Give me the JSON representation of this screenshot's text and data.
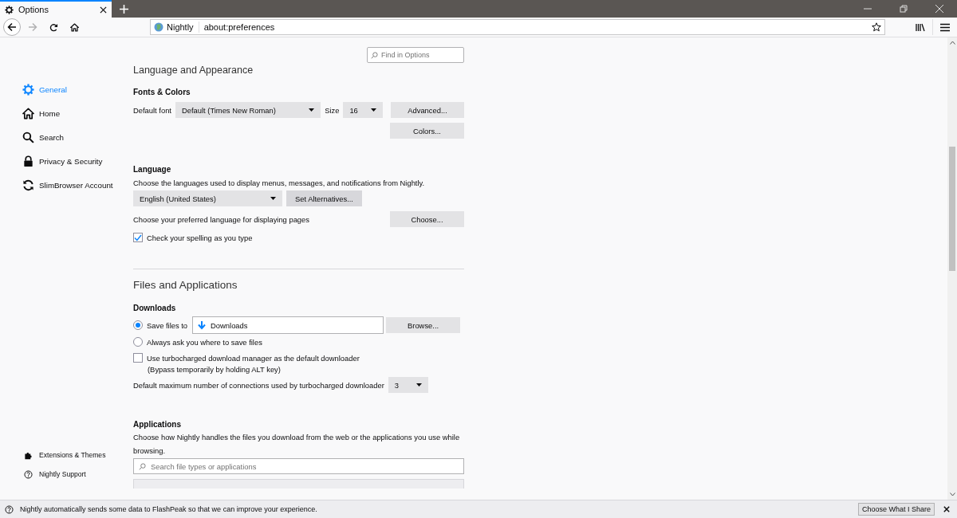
{
  "tab": {
    "title": "Options",
    "selected": true
  },
  "url_bar": {
    "identity": "Nightly",
    "url": "about:preferences"
  },
  "search": {
    "placeholder": "Find in Options"
  },
  "sidebar": {
    "items": [
      {
        "label": "General",
        "kind": "gear",
        "selected": true
      },
      {
        "label": "Home",
        "kind": "home",
        "selected": false
      },
      {
        "label": "Search",
        "kind": "search",
        "selected": false
      },
      {
        "label": "Privacy & Security",
        "kind": "lock",
        "selected": false
      },
      {
        "label": "SlimBrowser Account",
        "kind": "sync",
        "selected": false
      }
    ],
    "footer": [
      {
        "label": "Extensions & Themes",
        "kind": "puzzle"
      },
      {
        "label": "Nightly Support",
        "kind": "help"
      }
    ]
  },
  "main": {
    "cut_heading": "Language and Appearance",
    "fonts_colors": {
      "title": "Fonts & Colors",
      "default_font_label": "Default font",
      "default_font": "Default (Times New Roman)",
      "size_label": "Size",
      "size": "16",
      "buttons": [
        "Advanced...",
        "Colors..."
      ]
    },
    "language": {
      "title": "Language",
      "description": "Choose the languages used to display menus, messages, and notifications from Nightly.",
      "language": "English (United States)",
      "set_alternatives": "Set Alternatives...",
      "page_language_label": "Choose your preferred language for displaying pages",
      "choose_button": "Choose...",
      "spellcheck": {
        "label": "Check your spelling as you type",
        "checked": true
      }
    },
    "files": {
      "title": "Files and Applications",
      "downloads": {
        "title": "Downloads",
        "save_options": [
          {
            "label": "Save files to",
            "selected": true
          },
          {
            "label": "Always ask you where to save files",
            "selected": false
          }
        ],
        "folder": "Downloads",
        "browse": "Browse...",
        "turbo": {
          "label": "Use turbocharged download manager as the default downloader",
          "checked": false
        },
        "bypass_note": "(Bypass temporarily by holding ALT key)",
        "connections_label": "Default maximum number of connections used by turbocharged downloader",
        "connections": "3"
      },
      "applications": {
        "title": "Applications",
        "description": "Choose how Nightly handles the files you download from the web or the applications you use while browsing.",
        "search_placeholder": "Search file types or applications"
      }
    }
  },
  "notification": {
    "message": "Nightly automatically sends some data to FlashPeak so that we can improve your experience.",
    "button": "Choose What I Share"
  }
}
